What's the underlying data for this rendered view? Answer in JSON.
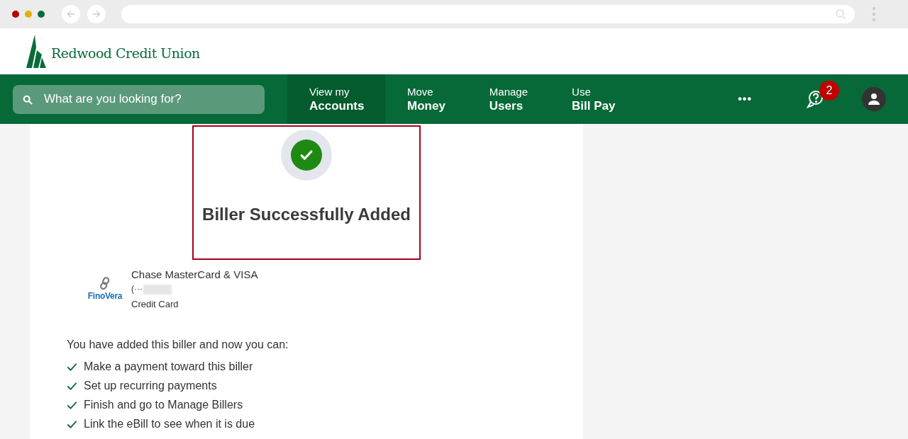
{
  "brand": {
    "name": "Redwood Credit Union"
  },
  "search": {
    "placeholder": "What are you looking for?"
  },
  "nav": [
    {
      "top": "View my",
      "bottom": "Accounts",
      "selected": true
    },
    {
      "top": "Move",
      "bottom": "Money",
      "selected": false
    },
    {
      "top": "Manage",
      "bottom": "Users",
      "selected": false
    },
    {
      "top": "Use",
      "bottom": "Bill Pay",
      "selected": false
    }
  ],
  "more": "•••",
  "help_badge": "2",
  "success": {
    "title": "Biller Successfully Added"
  },
  "biller": {
    "logo_text": "FinoVera",
    "name": "Chase MasterCard & VISA",
    "account": "(···",
    "type": "Credit Card"
  },
  "next_steps": {
    "intro": "You have added this biller and now you can:",
    "items": [
      "Make a payment toward this biller",
      "Set up recurring payments",
      "Finish and go to Manage Billers",
      "Link the eBill to see when it is due"
    ]
  }
}
